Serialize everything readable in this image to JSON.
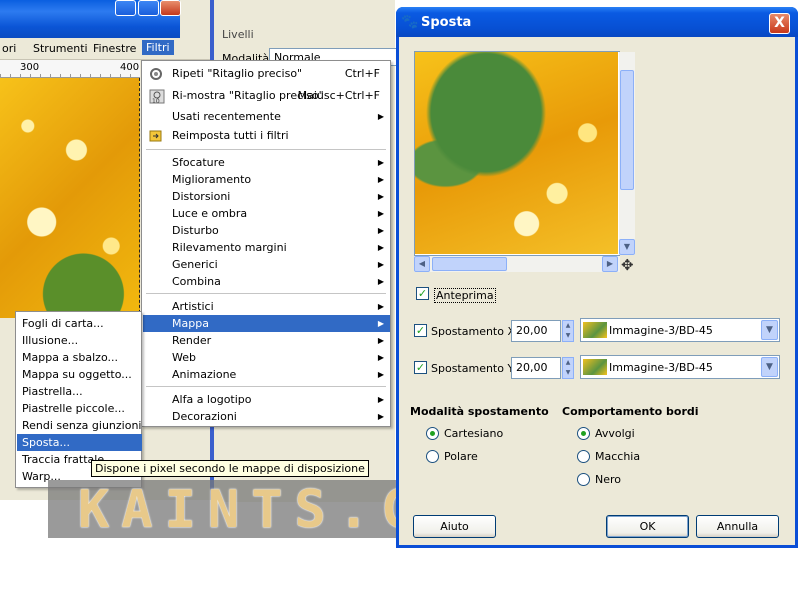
{
  "background_window": {
    "menubar": [
      "ori",
      "Strumenti",
      "Finestre",
      "Filtri"
    ],
    "ruler": [
      "300",
      "400"
    ],
    "side_panel": {
      "levels_label": "Livelli",
      "mode_label": "Modalità:",
      "mode_value": "Normale"
    }
  },
  "filters_menu": {
    "repeat": {
      "label": "Ripeti \"Ritaglio preciso\"",
      "shortcut": "Ctrl+F"
    },
    "reshow": {
      "label": "Ri-mostra \"Ritaglio preciso\"",
      "shortcut": "Maiusc+Ctrl+F"
    },
    "recent": "Usati recentemente",
    "reset": "Reimposta tutti i filtri",
    "group1": [
      "Sfocature",
      "Miglioramento",
      "Distorsioni",
      "Luce e ombra",
      "Disturbo",
      "Rilevamento margini",
      "Generici",
      "Combina"
    ],
    "group2": [
      "Artistici",
      "Mappa",
      "Render",
      "Web",
      "Animazione"
    ],
    "group3": [
      "Alfa a logotipo",
      "Decorazioni"
    ]
  },
  "map_submenu": {
    "items": [
      "Fogli di carta...",
      "Illusione...",
      "Mappa a sbalzo...",
      "Mappa su oggetto...",
      "Piastrella...",
      "Piastrelle piccole...",
      "Rendi senza giunzioni",
      "Sposta...",
      "Traccia frattale",
      "Warp..."
    ],
    "tooltip": "Dispone i pixel secondo le mappe di disposizione"
  },
  "watermark": "KAINTS.COM",
  "dialog": {
    "title": "Sposta",
    "close": "X",
    "preview_label": "Anteprima",
    "displacement_x": {
      "label": "Spostamento X",
      "value": "20,00",
      "map": "Immagine-3/BD-45"
    },
    "displacement_y": {
      "label": "Spostamento Y",
      "value": "20,00",
      "map": "Immagine-3/BD-45"
    },
    "mode_section": "Modalità spostamento",
    "mode_options": [
      "Cartesiano",
      "Polare"
    ],
    "edge_section": "Comportamento bordi",
    "edge_options": [
      "Avvolgi",
      "Macchia",
      "Nero"
    ],
    "buttons": {
      "help": "Aiuto",
      "ok": "OK",
      "cancel": "Annulla"
    }
  }
}
